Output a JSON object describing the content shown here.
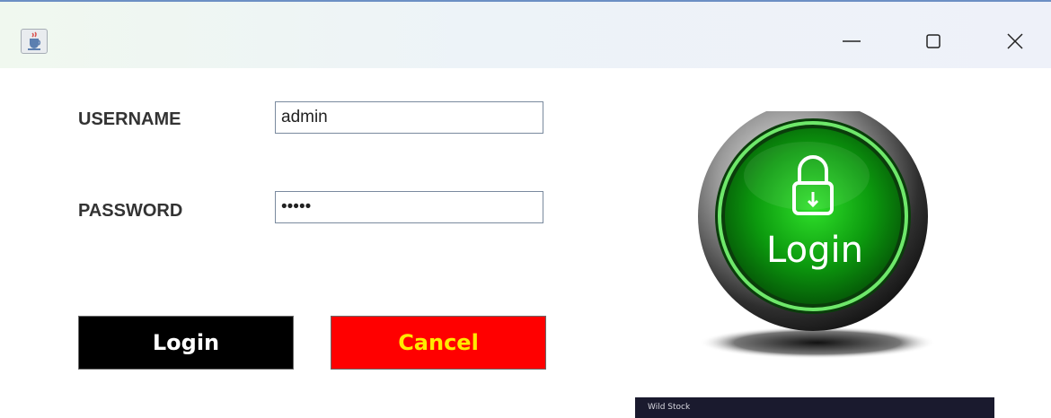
{
  "window": {
    "app_icon": "java-cup-icon",
    "controls": {
      "minimize": "minimize-icon",
      "maximize": "maximize-icon",
      "close": "close-icon"
    }
  },
  "form": {
    "username_label": "USERNAME",
    "username_value": "admin",
    "password_label": "PASSWORD",
    "password_value": "•••••"
  },
  "buttons": {
    "login_label": "Login",
    "cancel_label": "Cancel"
  },
  "graphic": {
    "badge_text": "Login",
    "icon": "padlock-icon",
    "watermark": "Wild Stock"
  },
  "colors": {
    "login_button_bg": "#000000",
    "login_button_text": "#ffffff",
    "cancel_button_bg": "#ff0000",
    "cancel_button_text": "#ffea00",
    "badge_green": "#12a514"
  }
}
